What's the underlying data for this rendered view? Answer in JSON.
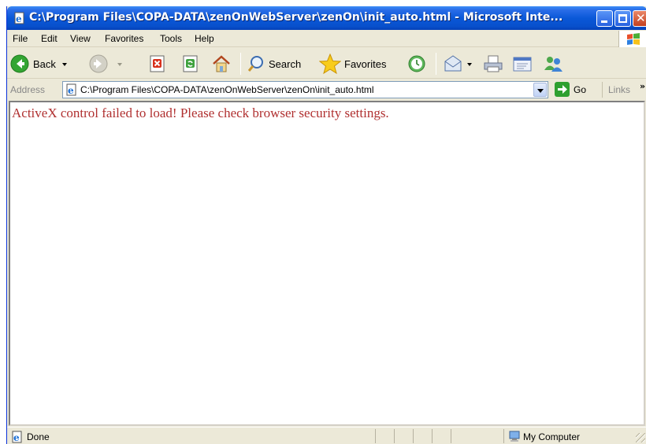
{
  "window": {
    "title": "C:\\Program Files\\COPA-DATA\\zenOnWebServer\\zenOn\\init_auto.html - Microsoft Inte..."
  },
  "menu": {
    "items": [
      "File",
      "Edit",
      "View",
      "Favorites",
      "Tools",
      "Help"
    ]
  },
  "toolbar": {
    "back_label": "Back",
    "search_label": "Search",
    "favorites_label": "Favorites"
  },
  "address": {
    "label": "Address",
    "url": "C:\\Program Files\\COPA-DATA\\zenOnWebServer\\zenOn\\init_auto.html",
    "go_label": "Go",
    "links_label": "Links",
    "links_chevron": "»"
  },
  "content": {
    "message": "ActiveX control failed to load! Please check browser security settings."
  },
  "status": {
    "text": "Done",
    "zone": "My Computer"
  },
  "icons": {
    "title": "ie-page-icon",
    "xp_logo": "windows-flag-icon",
    "back": "back-arrow-icon",
    "forward": "forward-arrow-icon",
    "stop": "stop-icon",
    "refresh": "refresh-icon",
    "home": "home-icon",
    "search": "magnifier-icon",
    "favorites": "star-icon",
    "history": "history-icon",
    "mail": "mail-icon",
    "print": "printer-icon",
    "edit": "edit-icon",
    "messenger": "messenger-icon",
    "go": "go-arrow-icon",
    "status_page": "ie-page-icon",
    "zone": "my-computer-icon"
  },
  "colors": {
    "title_bar": "#0a58d8",
    "error_text": "#b03030",
    "chrome": "#ece9d8"
  }
}
